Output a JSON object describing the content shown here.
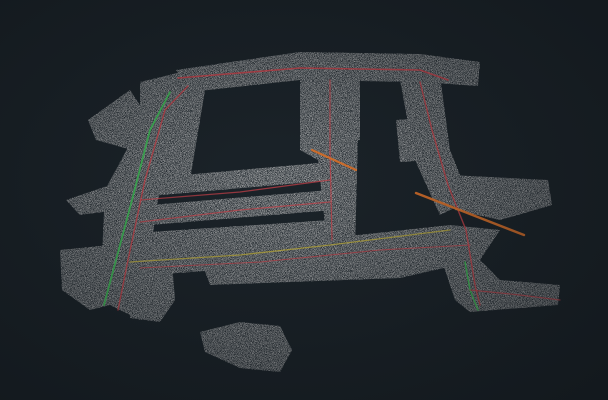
{
  "scene": {
    "subject": "",
    "background_color": "#1b2329",
    "point_color": "#d8d8d8",
    "trajectory_colors": {
      "red": "#d2434b",
      "green": "#3fc256",
      "orange": "#e0742a",
      "yellow": "#c8b63a"
    }
  }
}
